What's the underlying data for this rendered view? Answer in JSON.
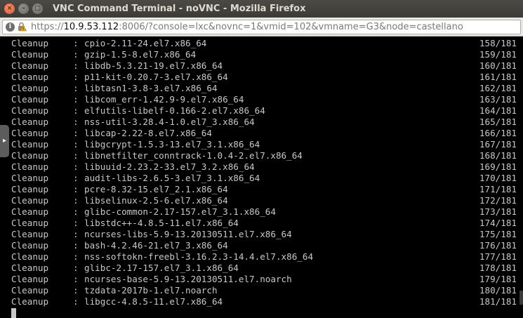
{
  "window": {
    "title": "VNC Command Terminal - noVNC - Mozilla Firefox",
    "close_glyph": "×",
    "min_glyph": "–",
    "max_glyph": "□"
  },
  "urlbar": {
    "scheme": "https://",
    "host": "10.9.53.112",
    "rest": ":8006/?console=lxc&novnc=1&vmid=102&vmname=G3&node=castellano",
    "info_glyph": "i"
  },
  "terminal": {
    "lines": [
      {
        "action": "Cleanup",
        "sep": ":",
        "pkg": "cpio-2.11-24.el7.x86_64",
        "count": "158/181"
      },
      {
        "action": "Cleanup",
        "sep": ":",
        "pkg": "gzip-1.5-8.el7.x86_64",
        "count": "159/181"
      },
      {
        "action": "Cleanup",
        "sep": ":",
        "pkg": "libdb-5.3.21-19.el7.x86_64",
        "count": "160/181"
      },
      {
        "action": "Cleanup",
        "sep": ":",
        "pkg": "p11-kit-0.20.7-3.el7.x86_64",
        "count": "161/181"
      },
      {
        "action": "Cleanup",
        "sep": ":",
        "pkg": "libtasn1-3.8-3.el7.x86_64",
        "count": "162/181"
      },
      {
        "action": "Cleanup",
        "sep": ":",
        "pkg": "libcom_err-1.42.9-9.el7.x86_64",
        "count": "163/181"
      },
      {
        "action": "Cleanup",
        "sep": ":",
        "pkg": "elfutils-libelf-0.166-2.el7.x86_64",
        "count": "164/181"
      },
      {
        "action": "Cleanup",
        "sep": ":",
        "pkg": "nss-util-3.28.4-1.0.el7_3.x86_64",
        "count": "165/181"
      },
      {
        "action": "Cleanup",
        "sep": ":",
        "pkg": "libcap-2.22-8.el7.x86_64",
        "count": "166/181"
      },
      {
        "action": "Cleanup",
        "sep": ":",
        "pkg": "libgcrypt-1.5.3-13.el7_3.1.x86_64",
        "count": "167/181"
      },
      {
        "action": "Cleanup",
        "sep": ":",
        "pkg": "libnetfilter_conntrack-1.0.4-2.el7.x86_64",
        "count": "168/181"
      },
      {
        "action": "Cleanup",
        "sep": ":",
        "pkg": "libuuid-2.23.2-33.el7_3.2.x86_64",
        "count": "169/181"
      },
      {
        "action": "Cleanup",
        "sep": ":",
        "pkg": "audit-libs-2.6.5-3.el7_3.1.x86_64",
        "count": "170/181"
      },
      {
        "action": "Cleanup",
        "sep": ":",
        "pkg": "pcre-8.32-15.el7_2.1.x86_64",
        "count": "171/181"
      },
      {
        "action": "Cleanup",
        "sep": ":",
        "pkg": "libselinux-2.5-6.el7.x86_64",
        "count": "172/181"
      },
      {
        "action": "Cleanup",
        "sep": ":",
        "pkg": "glibc-common-2.17-157.el7_3.1.x86_64",
        "count": "173/181"
      },
      {
        "action": "Cleanup",
        "sep": ":",
        "pkg": "libstdc++-4.8.5-11.el7.x86_64",
        "count": "174/181"
      },
      {
        "action": "Cleanup",
        "sep": ":",
        "pkg": "ncurses-libs-5.9-13.20130511.el7.x86_64",
        "count": "175/181"
      },
      {
        "action": "Cleanup",
        "sep": ":",
        "pkg": "bash-4.2.46-21.el7_3.x86_64",
        "count": "176/181"
      },
      {
        "action": "Cleanup",
        "sep": ":",
        "pkg": "nss-softokn-freebl-3.16.2.3-14.4.el7.x86_64",
        "count": "177/181"
      },
      {
        "action": "Cleanup",
        "sep": ":",
        "pkg": "glibc-2.17-157.el7_3.1.x86_64",
        "count": "178/181"
      },
      {
        "action": "Cleanup",
        "sep": ":",
        "pkg": "ncurses-base-5.9-13.20130511.el7.noarch",
        "count": "179/181"
      },
      {
        "action": "Cleanup",
        "sep": ":",
        "pkg": "tzdata-2017b-1.el7.noarch",
        "count": "180/181"
      },
      {
        "action": "Cleanup",
        "sep": ":",
        "pkg": "libgcc-4.8.5-11.el7.x86_64",
        "count": "181/181"
      }
    ]
  },
  "novnc_handle": {
    "glyph": "▸"
  },
  "colors": {
    "terminal_bg": "#000000",
    "terminal_fg": "#c8c8c8",
    "titlebar": "#3c3b37",
    "close_button": "#e0572a"
  }
}
